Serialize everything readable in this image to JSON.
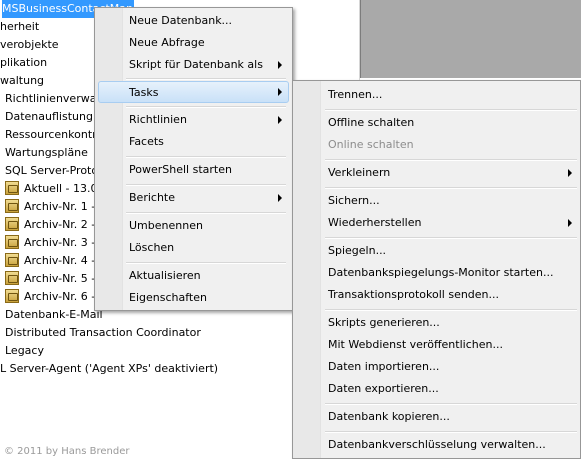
{
  "tree": {
    "selected_label": "MSBusinessContactManager",
    "items": [
      "herheit",
      "verobjekte",
      "plikation",
      "waltung",
      "Richtlinienverwa",
      "Datenauflistung",
      "Ressourcenkontr",
      "Wartungspläne",
      "SQL Server-Proto",
      "Aktuell - 13.0",
      "Archiv-Nr. 1 -",
      "Archiv-Nr. 2 -",
      "Archiv-Nr. 3 -",
      "Archiv-Nr. 4 -",
      "Archiv-Nr. 5 -",
      "Archiv-Nr. 6 -",
      "Datenbank-E-Mail",
      "Distributed Transaction Coordinator",
      "Legacy",
      "L Server-Agent ('Agent XPs' deaktiviert)"
    ]
  },
  "copyright": "© 2011 by Hans Brender",
  "context_menu": {
    "items": [
      {
        "label": "Neue Datenbank...",
        "submenu": false
      },
      {
        "label": "Neue Abfrage",
        "submenu": false
      },
      {
        "label": "Skript für Datenbank als",
        "submenu": true
      },
      {
        "label": "Tasks",
        "submenu": true,
        "highlighted": true
      },
      {
        "label": "Richtlinien",
        "submenu": true
      },
      {
        "label": "Facets",
        "submenu": false
      },
      {
        "label": "PowerShell starten",
        "submenu": false
      },
      {
        "label": "Berichte",
        "submenu": true
      },
      {
        "label": "Umbenennen",
        "submenu": false
      },
      {
        "label": "Löschen",
        "submenu": false
      },
      {
        "label": "Aktualisieren",
        "submenu": false
      },
      {
        "label": "Eigenschaften",
        "submenu": false
      }
    ]
  },
  "tasks_submenu": {
    "items": [
      {
        "label": "Trennen...",
        "submenu": false
      },
      {
        "label": "Offline schalten",
        "submenu": false
      },
      {
        "label": "Online schalten",
        "submenu": false,
        "disabled": true
      },
      {
        "label": "Verkleinern",
        "submenu": true
      },
      {
        "label": "Sichern...",
        "submenu": false
      },
      {
        "label": "Wiederherstellen",
        "submenu": true
      },
      {
        "label": "Spiegeln...",
        "submenu": false
      },
      {
        "label": "Datenbankspiegelungs-Monitor starten...",
        "submenu": false
      },
      {
        "label": "Transaktionsprotokoll senden...",
        "submenu": false
      },
      {
        "label": "Skripts generieren...",
        "submenu": false
      },
      {
        "label": "Mit Webdienst veröffentlichen...",
        "submenu": false
      },
      {
        "label": "Daten importieren...",
        "submenu": false
      },
      {
        "label": "Daten exportieren...",
        "submenu": false
      },
      {
        "label": "Datenbank kopieren...",
        "submenu": false
      },
      {
        "label": "Datenbankverschlüsselung verwalten...",
        "submenu": false
      }
    ]
  }
}
